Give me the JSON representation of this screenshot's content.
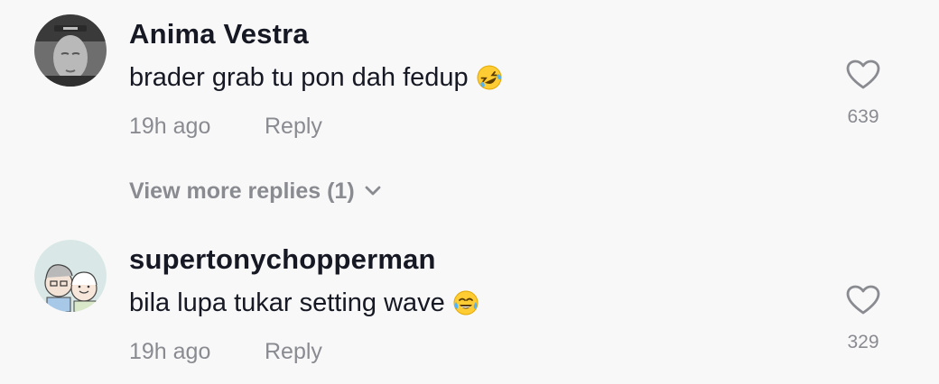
{
  "comments": [
    {
      "username": "Anima Vestra",
      "text": "brader grab tu pon dah fedup",
      "emoji_icon": "rolling-on-floor-laughing-emoji",
      "time": "19h ago",
      "reply_label": "Reply",
      "likes": "639"
    },
    {
      "username": "supertonychopperman",
      "text": "bila lupa tukar setting wave",
      "emoji_icon": "tears-of-joy-emoji",
      "time": "19h ago",
      "reply_label": "Reply",
      "likes": "329"
    }
  ],
  "view_more_replies": "View more replies (1)",
  "colors": {
    "background": "#f8f8f8",
    "text_primary": "#161823",
    "text_secondary": "#8a8b91"
  }
}
